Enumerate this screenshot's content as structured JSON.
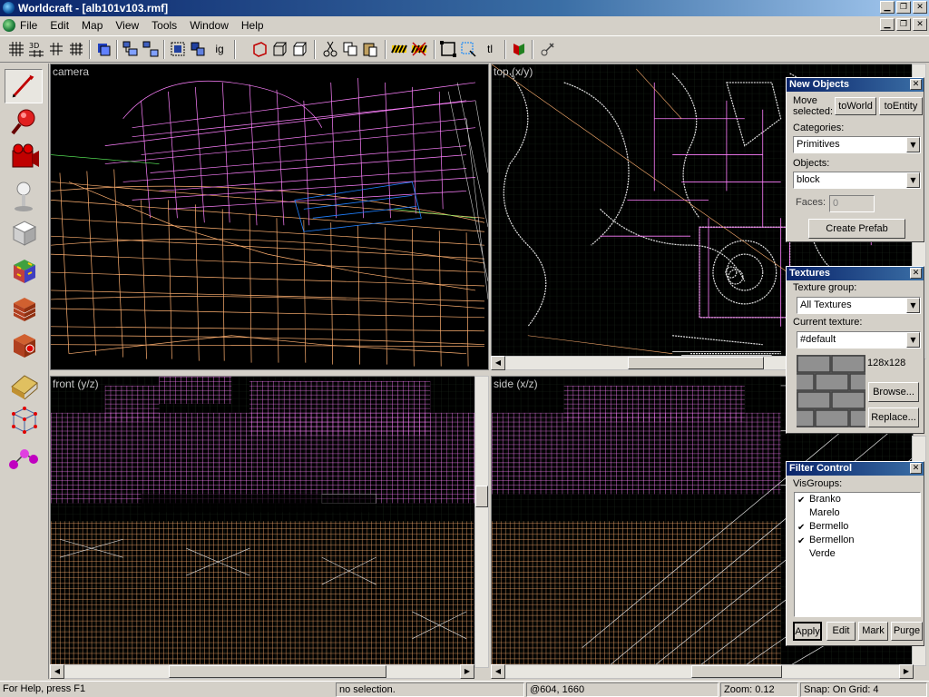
{
  "window": {
    "title": "Worldcraft - [alb101v103.rmf]"
  },
  "menu": [
    "File",
    "Edit",
    "Map",
    "View",
    "Tools",
    "Window",
    "Help"
  ],
  "toolbar": {
    "icons": [
      "grid-toggle-icon",
      "3d-grid-icon",
      "smaller-grid-icon",
      "larger-grid-icon",
      "load-window-state-icon",
      "group-icon",
      "ungroup-icon",
      "hide-items-icon",
      "show-hidden-icon",
      "ig-text-icon",
      "carve-icon",
      "hollow-icon",
      "ghost-icon",
      "cut-icon",
      "copy-icon",
      "paste-icon",
      "texture-lock-icon",
      "hazard-icon",
      "selection-box-icon",
      "selection-handles-icon",
      "texture-icon",
      "run-map-icon",
      "compile-icon"
    ],
    "ig_label": "ig",
    "tl_label": "tl"
  },
  "left_tools": [
    "pointer-tool-icon",
    "magnify-tool-icon",
    "camera-tool-icon",
    "entity-tool-icon",
    "block-tool-icon",
    "texture-app-icon",
    "apply-texture-icon",
    "decal-tool-icon",
    "clip-tool-icon",
    "vertex-tool-icon",
    "path-tool-icon"
  ],
  "viewports": {
    "camera": {
      "label": "camera"
    },
    "top": {
      "label": "top (x/y)"
    },
    "front": {
      "label": "front (y/z)"
    },
    "side": {
      "label": "side (x/z)"
    }
  },
  "new_objects": {
    "title": "New Objects",
    "move_selected_label_1": "Move",
    "move_selected_label_2": "selected:",
    "to_world": "toWorld",
    "to_entity": "toEntity",
    "categories_label": "Categories:",
    "categories_value": "Primitives",
    "objects_label": "Objects:",
    "objects_value": "block",
    "faces_label": "Faces:",
    "faces_value": "0",
    "create_prefab": "Create Prefab"
  },
  "textures": {
    "title": "Textures",
    "group_label": "Texture group:",
    "group_value": "All Textures",
    "current_label": "Current texture:",
    "current_value": "#default",
    "size": "128x128",
    "browse": "Browse...",
    "replace": "Replace..."
  },
  "filter_control": {
    "title": "Filter Control",
    "visgroups_label": "VisGroups:",
    "visgroups": [
      {
        "name": "Branko",
        "checked": true
      },
      {
        "name": "Marelo",
        "checked": false
      },
      {
        "name": "Bermello",
        "checked": true
      },
      {
        "name": "Bermellon",
        "checked": true
      },
      {
        "name": "Verde",
        "checked": false
      }
    ],
    "apply": "Apply",
    "edit": "Edit",
    "mark": "Mark",
    "purge": "Purge"
  },
  "status": {
    "help": "For Help, press F1",
    "selection": "no selection.",
    "coords": "@604, 1660",
    "zoom": "Zoom: 0.12",
    "snap": "Snap: On Grid: 4"
  },
  "colors": {
    "orange_wire": "#ffb070",
    "pink_wire": "#ff80ff",
    "grid": "#1c2a1c",
    "title_blue": "#0a246a"
  }
}
